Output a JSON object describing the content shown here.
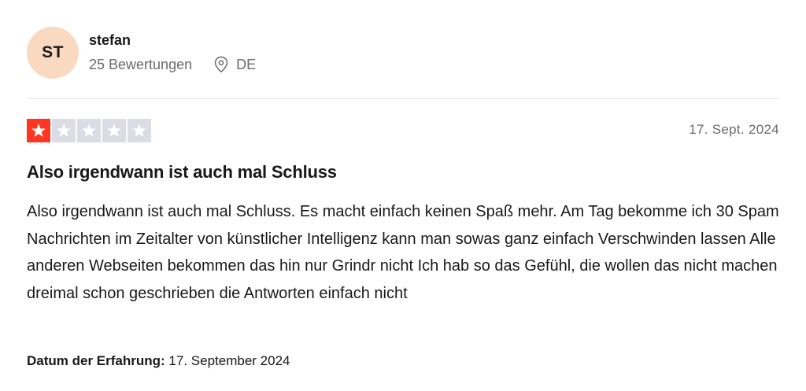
{
  "reviewer": {
    "initials": "ST",
    "name": "stefan",
    "reviews_count": "25 Bewertungen",
    "country": "DE",
    "avatar_color": "#f9d9c0",
    "location_icon": "map-pin-icon"
  },
  "review": {
    "rating": 1,
    "max_rating": 5,
    "star_filled_color": "#ff3722",
    "star_empty_color": "#dcdce6",
    "date": "17. Sept. 2024",
    "title": "Also irgendwann ist auch mal Schluss",
    "text": "Also irgendwann ist auch mal Schluss. Es macht einfach keinen Spaß mehr. Am Tag bekomme ich 30 Spam Nachrichten im Zeitalter von künstlicher Intelligenz kann man sowas ganz einfach Verschwinden lassen Alle anderen Webseiten bekommen das hin nur Grindr nicht Ich hab so das Gefühl, die wollen das nicht machen dreimal schon geschrieben die Antworten einfach nicht",
    "experience_label": "Datum der Erfahrung:",
    "experience_date": "17. September 2024"
  }
}
